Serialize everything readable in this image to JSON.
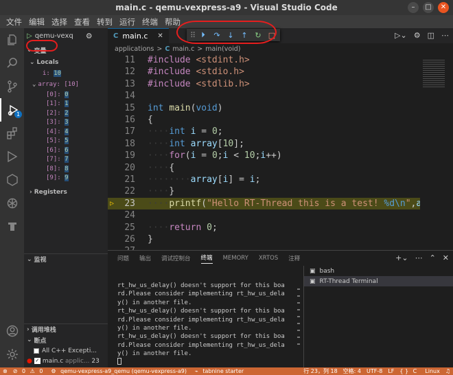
{
  "window": {
    "title": "main.c - qemu-vexpress-a9 - Visual Studio Code"
  },
  "menu": [
    "文件",
    "编辑",
    "选择",
    "查看",
    "转到",
    "运行",
    "终端",
    "帮助"
  ],
  "debug": {
    "config_name": "qemu-vexq",
    "variables_header": "变量",
    "locals_label": "Locals",
    "i_name": "i:",
    "i_value": "10",
    "array_label": "array: [10]",
    "array_items": [
      {
        "k": "[0]:",
        "v": "0"
      },
      {
        "k": "[1]:",
        "v": "1"
      },
      {
        "k": "[2]:",
        "v": "2"
      },
      {
        "k": "[3]:",
        "v": "3"
      },
      {
        "k": "[4]:",
        "v": "4"
      },
      {
        "k": "[5]:",
        "v": "5"
      },
      {
        "k": "[6]:",
        "v": "6"
      },
      {
        "k": "[7]:",
        "v": "7"
      },
      {
        "k": "[8]:",
        "v": "8"
      },
      {
        "k": "[9]:",
        "v": "9"
      }
    ],
    "registers_label": "Registers",
    "watch_header": "监视",
    "callstack_header": "调用堆栈",
    "breakpoints_header": "断点",
    "bp_all": "All C++ Excepti...",
    "bp_file": "main.c",
    "bp_path": "applic...",
    "bp_line": "23",
    "badge": "1"
  },
  "editor": {
    "tab_label": "main.c",
    "tab_lang": "C",
    "crumbs": [
      "applications",
      ">",
      "C",
      "main.c",
      ">",
      "main(void)"
    ],
    "current_line": "23"
  },
  "code": [
    {
      "n": "11",
      "h": "<span class=\"pp\">#include</span> <span class=\"str\">&lt;stdint.h&gt;</span>"
    },
    {
      "n": "12",
      "h": "<span class=\"pp\">#include</span> <span class=\"str\">&lt;stdio.h&gt;</span>"
    },
    {
      "n": "13",
      "h": "<span class=\"pp\">#include</span> <span class=\"str\">&lt;stdlib.h&gt;</span>"
    },
    {
      "n": "14",
      "h": ""
    },
    {
      "n": "15",
      "h": "<span class=\"ty\">int</span> <span class=\"fn\">main</span>(<span class=\"ty\">void</span>)"
    },
    {
      "n": "16",
      "h": "{"
    },
    {
      "n": "17",
      "h": "<span class=\"dots\">····</span><span class=\"ty\">int</span> <span class=\"id\">i</span> = <span class=\"num\">0</span>;"
    },
    {
      "n": "18",
      "h": "<span class=\"dots\">····</span><span class=\"ty\">int</span> <span class=\"id\">array</span>[<span class=\"num\">10</span>];"
    },
    {
      "n": "19",
      "h": "<span class=\"dots\">····</span><span class=\"pp\">for</span>(<span class=\"id\">i</span> = <span class=\"num\">0</span>;<span class=\"id\">i</span> &lt; <span class=\"num\">10</span>;<span class=\"id\">i</span>++)"
    },
    {
      "n": "20",
      "h": "<span class=\"dots\">····</span>{"
    },
    {
      "n": "21",
      "h": "<span class=\"dots\">········</span><span class=\"id\">array</span>[<span class=\"id\">i</span>] = <span class=\"id\">i</span>;"
    },
    {
      "n": "22",
      "h": "<span class=\"dots\">····</span>}"
    },
    {
      "n": "23",
      "h": "<span class=\"dots\">····</span><span class=\"fn\">printf</span>(<span class=\"str\">\"Hello RT-Thread this is a test! </span><span class=\"kw\">%d\\n</span><span class=\"str\">\"</span>,<span class=\"id\">a</span>"
    },
    {
      "n": "24",
      "h": ""
    },
    {
      "n": "25",
      "h": "<span class=\"dots\">····</span><span class=\"pp\">return</span> <span class=\"num\">0</span>;"
    },
    {
      "n": "26",
      "h": "}"
    },
    {
      "n": "27",
      "h": ""
    }
  ],
  "panel": {
    "tabs": [
      "问题",
      "输出",
      "调试控制台",
      "终端",
      "MEMORY",
      "XRTOS",
      "注释"
    ],
    "active_tab": "终端",
    "terminal_lines": [
      "rt_hw_us_delay() doesn't support for this boa",
      "rd.Please consider implementing rt_hw_us_dela",
      "y() in another file.",
      "rt_hw_us_delay() doesn't support for this boa",
      "rd.Please consider implementing rt_hw_us_dela",
      "y() in another file.",
      "rt_hw_us_delay() doesn't support for this boa",
      "rd.Please consider implementing rt_hw_us_dela",
      "y() in another file."
    ],
    "terminals": [
      "bash",
      "RT-Thread Terminal"
    ]
  },
  "status": {
    "errors": "0",
    "warnings": "0",
    "launch": "qemu-vexpress-a9_qemu (qemu-vexpress-a9)",
    "tabnine": "tabnine starter",
    "position": "行 23，列 18",
    "spaces": "空格: 4",
    "encoding": "UTF-8",
    "eol": "LF",
    "lang": "C",
    "os": "Linux"
  }
}
